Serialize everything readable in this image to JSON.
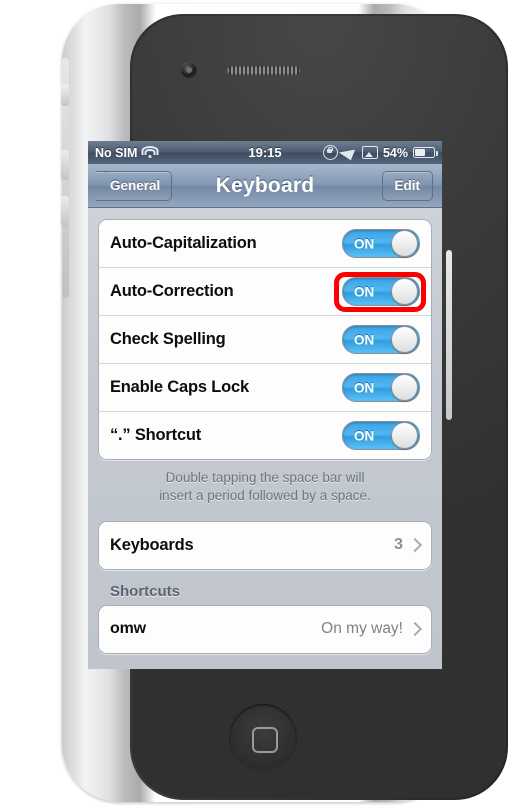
{
  "device": {
    "name": "iphone",
    "camera_icon": "front-camera",
    "speaker_icon": "earpiece-speaker",
    "home_button_icon": "home-button"
  },
  "status_bar": {
    "carrier": "No SIM",
    "wifi_icon": "wifi-icon",
    "time": "19:15",
    "rotation_lock_icon": "rotation-lock-icon",
    "location_icon": "location-arrow-icon",
    "airplay_icon": "airplay-icon",
    "battery_percent": "54%",
    "battery_icon": "battery-icon",
    "battery_level": 54
  },
  "nav_bar": {
    "back_label": "General",
    "title": "Keyboard",
    "edit_label": "Edit"
  },
  "settings": {
    "toggles": [
      {
        "label": "Auto-Capitalization",
        "value": "ON",
        "highlighted": false
      },
      {
        "label": "Auto-Correction",
        "value": "ON",
        "highlighted": true
      },
      {
        "label": "Check Spelling",
        "value": "ON",
        "highlighted": false
      },
      {
        "label": "Enable Caps Lock",
        "value": "ON",
        "highlighted": false
      },
      {
        "label": "“.” Shortcut",
        "value": "ON",
        "highlighted": false
      }
    ],
    "footnote_line1": "Double tapping the space bar will",
    "footnote_line2": "insert a period followed by a space.",
    "keyboards_row": {
      "label": "Keyboards",
      "value": "3",
      "chevron_icon": "chevron-right-icon"
    },
    "shortcuts_header": "Shortcuts",
    "shortcut_row": {
      "label": "omw",
      "value": "On my way!",
      "chevron_icon": "chevron-right-icon"
    }
  },
  "annotation": {
    "ring_color": "#fb0000",
    "target": "Auto-Correction"
  }
}
